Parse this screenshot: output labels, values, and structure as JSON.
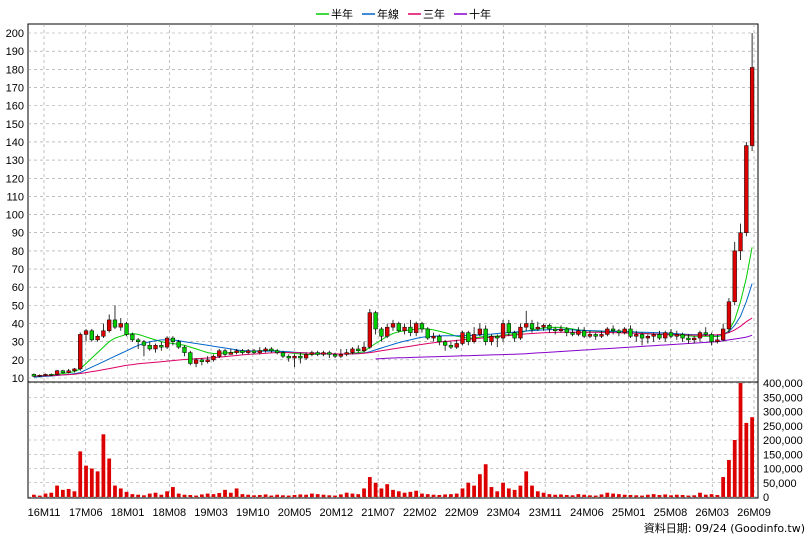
{
  "chart_data": {
    "type": "candlestick",
    "legend": [
      {
        "name": "半年",
        "color": "#00cc00"
      },
      {
        "name": "年線",
        "color": "#0066cc"
      },
      {
        "name": "三年",
        "color": "#dd0066"
      },
      {
        "name": "十年",
        "color": "#8800cc"
      }
    ],
    "price_axis": {
      "ylim": [
        10,
        200
      ],
      "ticks": [
        "200",
        "190",
        "180",
        "170",
        "160",
        "150",
        "140",
        "130",
        "120",
        "110",
        "100",
        "90",
        "80",
        "70",
        "60",
        "50",
        "40",
        "30",
        "20",
        "10"
      ]
    },
    "volume_axis": {
      "ylim": [
        0,
        400000
      ],
      "ticks": [
        "400,000",
        "350,000",
        "300,000",
        "250,000",
        "200,000",
        "150,000",
        "100,000",
        "50,000",
        "0"
      ]
    },
    "x_ticks": [
      "16M11",
      "17M06",
      "18M01",
      "18M08",
      "19M03",
      "19M10",
      "20M05",
      "20M12",
      "21M07",
      "22M02",
      "22M09",
      "23M04",
      "23M11",
      "24M06",
      "25M01",
      "25M08",
      "26M03",
      "26M09"
    ],
    "up_color": "#dd0000",
    "down_color": "#00cc00",
    "volume_color": "#dd0000",
    "grid": true,
    "footer": "資料日期: 09/24  (Goodinfo.tw)",
    "candles": [
      [
        12,
        11,
        12.5,
        10.5,
        8000
      ],
      [
        11,
        11.5,
        12,
        10.5,
        5000
      ],
      [
        11.5,
        12,
        12.5,
        11,
        12000
      ],
      [
        12,
        11.5,
        12.5,
        11,
        15000
      ],
      [
        12,
        14,
        14.5,
        11.5,
        40000
      ],
      [
        14,
        13,
        14.5,
        12.5,
        25000
      ],
      [
        13,
        14,
        15,
        12.5,
        28000
      ],
      [
        14,
        15,
        15.5,
        13,
        20000
      ],
      [
        15,
        34,
        35,
        14,
        160000
      ],
      [
        34,
        36,
        37,
        30,
        110000
      ],
      [
        36,
        31,
        37,
        30,
        100000
      ],
      [
        31,
        33,
        34,
        30,
        90000
      ],
      [
        33,
        36,
        40,
        32,
        220000
      ],
      [
        36,
        42,
        45,
        35,
        135000
      ],
      [
        42,
        38,
        50,
        37,
        40000
      ],
      [
        38,
        40,
        43,
        36,
        30000
      ],
      [
        40,
        34,
        41,
        33,
        18000
      ],
      [
        34,
        31,
        35,
        30,
        10000
      ],
      [
        31,
        30,
        32,
        26,
        8000
      ],
      [
        30,
        28,
        31,
        22,
        6000
      ],
      [
        28,
        26,
        30,
        25,
        12000
      ],
      [
        26,
        28,
        29,
        24,
        15000
      ],
      [
        28,
        27,
        30,
        25,
        8000
      ],
      [
        27,
        32,
        33,
        26,
        20000
      ],
      [
        32,
        30,
        33,
        28,
        35000
      ],
      [
        30,
        27,
        31,
        26,
        12000
      ],
      [
        27,
        24,
        28,
        22,
        8000
      ],
      [
        24,
        18,
        25,
        17,
        7000
      ],
      [
        18,
        20,
        21,
        16,
        5000
      ],
      [
        20,
        19,
        21,
        17,
        9000
      ],
      [
        19,
        20,
        22,
        18,
        12000
      ],
      [
        20,
        22,
        23,
        19,
        10000
      ],
      [
        22,
        25,
        26,
        21,
        14000
      ],
      [
        25,
        23,
        26,
        22,
        25000
      ],
      [
        23,
        24,
        26,
        23,
        15000
      ],
      [
        24,
        25,
        26,
        23,
        30000
      ],
      [
        25,
        24,
        26,
        23,
        10000
      ],
      [
        24,
        25,
        26,
        23,
        8000
      ],
      [
        25,
        24,
        26,
        23,
        6000
      ],
      [
        24,
        25,
        27,
        23,
        7000
      ],
      [
        25,
        26,
        27,
        24,
        9000
      ],
      [
        26,
        25,
        27,
        24,
        5000
      ],
      [
        25,
        24,
        26,
        23,
        8000
      ],
      [
        24,
        22,
        25,
        21,
        6000
      ],
      [
        22,
        21,
        23,
        19,
        5000
      ],
      [
        21,
        22,
        23,
        16,
        7000
      ],
      [
        22,
        21,
        24,
        18,
        9000
      ],
      [
        21,
        23,
        24,
        20,
        8000
      ],
      [
        23,
        24,
        25,
        22,
        12000
      ],
      [
        24,
        23,
        25,
        22,
        10000
      ],
      [
        23,
        24,
        25,
        22,
        8000
      ],
      [
        24,
        23,
        25,
        21,
        6000
      ],
      [
        23,
        22,
        24,
        21,
        5000
      ],
      [
        22,
        23,
        26,
        21,
        9000
      ],
      [
        23,
        24,
        26,
        22,
        15000
      ],
      [
        24,
        26,
        27,
        23,
        12000
      ],
      [
        26,
        25,
        28,
        24,
        10000
      ],
      [
        25,
        27,
        30,
        24,
        30000
      ],
      [
        27,
        46,
        48,
        26,
        70000
      ],
      [
        46,
        37,
        47,
        34,
        50000
      ],
      [
        37,
        33,
        38,
        30,
        30000
      ],
      [
        33,
        38,
        40,
        32,
        45000
      ],
      [
        38,
        40,
        42,
        36,
        25000
      ],
      [
        40,
        36,
        41,
        35,
        20000
      ],
      [
        36,
        38,
        40,
        34,
        15000
      ],
      [
        38,
        35,
        42,
        33,
        18000
      ],
      [
        35,
        40,
        41,
        33,
        22000
      ],
      [
        40,
        37,
        41,
        35,
        12000
      ],
      [
        37,
        32,
        38,
        31,
        10000
      ],
      [
        32,
        33,
        35,
        30,
        8000
      ],
      [
        33,
        30,
        34,
        28,
        7000
      ],
      [
        30,
        28,
        31,
        25,
        9000
      ],
      [
        28,
        27,
        30,
        26,
        10000
      ],
      [
        27,
        29,
        31,
        26,
        12000
      ],
      [
        29,
        35,
        36,
        28,
        30000
      ],
      [
        35,
        30,
        36,
        28,
        50000
      ],
      [
        30,
        34,
        38,
        29,
        40000
      ],
      [
        34,
        37,
        40,
        33,
        80000
      ],
      [
        37,
        30,
        39,
        28,
        115000
      ],
      [
        30,
        33,
        34,
        28,
        35000
      ],
      [
        33,
        32,
        34,
        27,
        20000
      ],
      [
        32,
        40,
        42,
        30,
        50000
      ],
      [
        40,
        35,
        42,
        33,
        30000
      ],
      [
        35,
        32,
        36,
        30,
        25000
      ],
      [
        32,
        38,
        40,
        31,
        40000
      ],
      [
        38,
        40,
        47,
        36,
        90000
      ],
      [
        40,
        37,
        42,
        35,
        40000
      ],
      [
        37,
        38,
        41,
        36,
        20000
      ],
      [
        38,
        39,
        40,
        36,
        15000
      ],
      [
        39,
        37,
        40,
        35,
        10000
      ],
      [
        37,
        36,
        38,
        34,
        8000
      ],
      [
        36,
        37,
        39,
        35,
        9000
      ],
      [
        37,
        35,
        38,
        33,
        7000
      ],
      [
        35,
        34,
        37,
        33,
        6000
      ],
      [
        34,
        36,
        38,
        33,
        10000
      ],
      [
        36,
        33,
        38,
        32,
        8000
      ],
      [
        33,
        34,
        36,
        32,
        6000
      ],
      [
        34,
        33,
        35,
        31,
        5000
      ],
      [
        33,
        34,
        36,
        32,
        9000
      ],
      [
        34,
        37,
        38,
        33,
        15000
      ],
      [
        37,
        36,
        39,
        34,
        12000
      ],
      [
        36,
        35,
        37,
        33,
        10000
      ],
      [
        35,
        37,
        38,
        34,
        8000
      ],
      [
        37,
        33,
        39,
        32,
        7000
      ],
      [
        33,
        34,
        36,
        30,
        6000
      ],
      [
        34,
        32,
        35,
        28,
        5000
      ],
      [
        32,
        33,
        34,
        29,
        8000
      ],
      [
        33,
        34,
        35,
        30,
        10000
      ],
      [
        34,
        32,
        36,
        31,
        7000
      ],
      [
        32,
        35,
        36,
        30,
        9000
      ],
      [
        35,
        33,
        37,
        32,
        6000
      ],
      [
        33,
        34,
        36,
        31,
        8000
      ],
      [
        34,
        32,
        35,
        30,
        7000
      ],
      [
        32,
        31,
        34,
        29,
        5000
      ],
      [
        31,
        32,
        33,
        29,
        6000
      ],
      [
        32,
        35,
        36,
        30,
        15000
      ],
      [
        35,
        34,
        38,
        33,
        8000
      ],
      [
        34,
        30,
        35,
        28,
        10000
      ],
      [
        30,
        31,
        34,
        29,
        7000
      ],
      [
        31,
        37,
        40,
        30,
        70000
      ],
      [
        37,
        52,
        54,
        35,
        130000
      ],
      [
        52,
        80,
        85,
        50,
        200000
      ],
      [
        80,
        90,
        95,
        75,
        400000
      ],
      [
        90,
        138,
        140,
        88,
        260000
      ],
      [
        138,
        181,
        200,
        135,
        280000
      ]
    ],
    "ma": {
      "半年": [
        11,
        11.2,
        11.4,
        11.6,
        12,
        12.5,
        13,
        13.5,
        15,
        18,
        21,
        24,
        27,
        30,
        32,
        33,
        34,
        34.5,
        34,
        33,
        32,
        31,
        30,
        29.5,
        29,
        28.5,
        28,
        27,
        26,
        25,
        24,
        23.5,
        23.5,
        23.8,
        24,
        24.3,
        24.5,
        24.7,
        24.8,
        25,
        25.2,
        25.3,
        25,
        24.5,
        24,
        23.5,
        23.2,
        23,
        23,
        23.2,
        23.3,
        23.3,
        23.2,
        23.2,
        23.3,
        23.6,
        24,
        24.5,
        27,
        29,
        31,
        33,
        34.5,
        35.5,
        36,
        36.5,
        37,
        37.2,
        37,
        36.5,
        35.8,
        35,
        34,
        33,
        32.5,
        32,
        32,
        32.5,
        33,
        33,
        33,
        33.5,
        34,
        34.5,
        35,
        35.8,
        36.5,
        37,
        37.5,
        37.8,
        38,
        37.8,
        37.5,
        37,
        36.5,
        36.2,
        36,
        35.8,
        35.5,
        35.5,
        35.6,
        35.8,
        35.8,
        35.6,
        35.2,
        34.8,
        34.5,
        34.2,
        34,
        33.9,
        33.8,
        33.6,
        33.4,
        33.2,
        33,
        33,
        33,
        33,
        32.8,
        33.5,
        36,
        42,
        52,
        65,
        82
      ],
      "年線": [
        10.5,
        10.7,
        10.9,
        11.1,
        11.4,
        11.7,
        12,
        12.4,
        13,
        14.5,
        16,
        17.5,
        19,
        20.5,
        22,
        23.5,
        25,
        26.5,
        28,
        29,
        30,
        30.5,
        31,
        31,
        31,
        30.5,
        30,
        29.5,
        29,
        28.5,
        28,
        27.5,
        27,
        26.5,
        26,
        25.5,
        25,
        25,
        24.8,
        24.8,
        24.8,
        24.8,
        24.7,
        24.6,
        24.5,
        24.2,
        24,
        23.8,
        23.6,
        23.5,
        23.4,
        23.3,
        23.2,
        23.2,
        23.2,
        23.3,
        23.5,
        23.7,
        24.5,
        25.5,
        26.5,
        27.5,
        28.5,
        29.5,
        30.3,
        31,
        31.8,
        32.4,
        32.8,
        33,
        33.2,
        33.3,
        33.3,
        33.3,
        33.3,
        33.4,
        33.5,
        33.7,
        34,
        34.2,
        34.5,
        34.8,
        35,
        35.3,
        35.6,
        35.9,
        36.1,
        36.3,
        36.5,
        36.6,
        36.7,
        36.7,
        36.6,
        36.5,
        36.3,
        36.2,
        36.1,
        36,
        35.9,
        35.8,
        35.7,
        35.6,
        35.5,
        35.4,
        35.3,
        35.2,
        35.1,
        35,
        34.9,
        34.8,
        34.6,
        34.4,
        34.2,
        34,
        33.9,
        33.8,
        33.7,
        33.6,
        33.5,
        34,
        35.5,
        39,
        44,
        52,
        62
      ],
      "三年": [
        11,
        11.1,
        11.2,
        11.3,
        11.5,
        11.7,
        11.9,
        12.1,
        12.5,
        13,
        13.5,
        14,
        14.6,
        15.2,
        15.8,
        16.4,
        17,
        17.4,
        17.8,
        18.1,
        18.4,
        18.7,
        19,
        19.3,
        19.6,
        19.9,
        20.2,
        20.4,
        20.6,
        20.8,
        21,
        21.2,
        21.5,
        21.8,
        22.1,
        22.4,
        22.7,
        23,
        23.2,
        23.4,
        23.6,
        23.8,
        24,
        24,
        24,
        24,
        23.9,
        23.8,
        23.7,
        23.6,
        23.5,
        23.4,
        23.3,
        23.2,
        23.2,
        23.3,
        23.4,
        23.6,
        24,
        24.5,
        25,
        25.5,
        26,
        26.5,
        27,
        27.5,
        28,
        28.5,
        29,
        29.4,
        29.8,
        30.1,
        30.4,
        30.7,
        31,
        31.3,
        31.6,
        31.9,
        32.2,
        32.5,
        32.8,
        33.1,
        33.4,
        33.7,
        34,
        34.3,
        34.5,
        34.7,
        34.9,
        35,
        35.1,
        35.2,
        35.2,
        35.2,
        35.2,
        35.2,
        35.2,
        35.2,
        35.1,
        35.1,
        35,
        34.9,
        34.8,
        34.7,
        34.6,
        34.5,
        34.4,
        34.3,
        34.2,
        34.1,
        34,
        33.9,
        33.8,
        33.7,
        33.6,
        33.5,
        33.5,
        33.6,
        33.8,
        34.2,
        35,
        36.5,
        38.5,
        41,
        43
      ],
      "十年": [
        null,
        null,
        null,
        null,
        null,
        null,
        null,
        null,
        null,
        null,
        null,
        null,
        null,
        null,
        null,
        null,
        null,
        null,
        null,
        null,
        null,
        null,
        null,
        null,
        null,
        null,
        null,
        null,
        null,
        null,
        null,
        null,
        null,
        null,
        null,
        null,
        null,
        null,
        null,
        null,
        null,
        null,
        null,
        null,
        null,
        null,
        null,
        null,
        null,
        null,
        null,
        null,
        null,
        null,
        null,
        null,
        null,
        null,
        null,
        20.5,
        20.7,
        20.9,
        21,
        21.1,
        21.2,
        21.3,
        21.4,
        21.5,
        21.6,
        21.7,
        21.8,
        21.9,
        22,
        22.1,
        22.2,
        22.3,
        22.4,
        22.5,
        22.6,
        22.7,
        22.8,
        22.9,
        23,
        23.1,
        23.2,
        23.4,
        23.6,
        23.8,
        24,
        24.2,
        24.4,
        24.6,
        24.8,
        25,
        25.2,
        25.4,
        25.6,
        25.8,
        26,
        26.2,
        26.4,
        26.6,
        26.8,
        27,
        27.2,
        27.4,
        27.6,
        27.8,
        28,
        28.2,
        28.4,
        28.6,
        28.8,
        29,
        29.2,
        29.4,
        29.6,
        29.8,
        30,
        30.5,
        31,
        31.5,
        32,
        32.5,
        33.5
      ]
    }
  }
}
